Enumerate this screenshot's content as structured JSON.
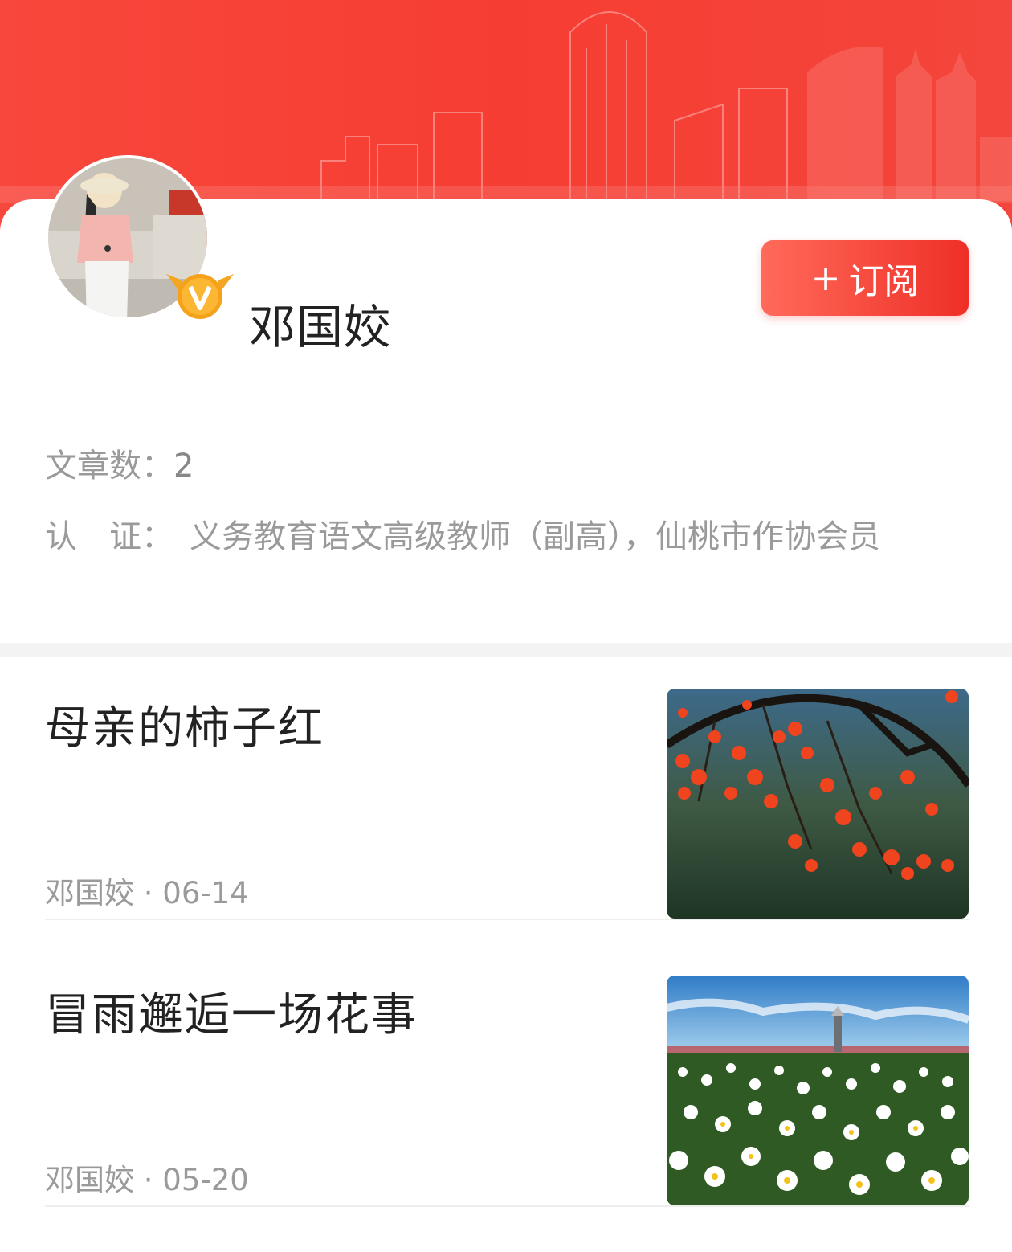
{
  "author": {
    "name": "邓国姣",
    "avatar_icon": "user-avatar-photo",
    "badge_icon": "verified-v-badge"
  },
  "subscribe": {
    "plus": "+",
    "label": "订阅"
  },
  "stats": {
    "articles_label": "文章数：",
    "articles_count": "2",
    "cert_label": "认　证：",
    "cert_value": "义务教育语文高级教师（副高），仙桃市作协会员"
  },
  "articles": [
    {
      "title": "母亲的柿子红",
      "meta": "邓国姣 · 06-14",
      "thumb_icon": "persimmon-tree-photo"
    },
    {
      "title": "冒雨邂逅一场花事",
      "meta": "邓国姣 · 05-20",
      "thumb_icon": "daisy-field-photo"
    }
  ],
  "colors": {
    "brand_red": "#f63d33",
    "text_dark": "#222222",
    "text_gray": "#9a9a9a"
  }
}
